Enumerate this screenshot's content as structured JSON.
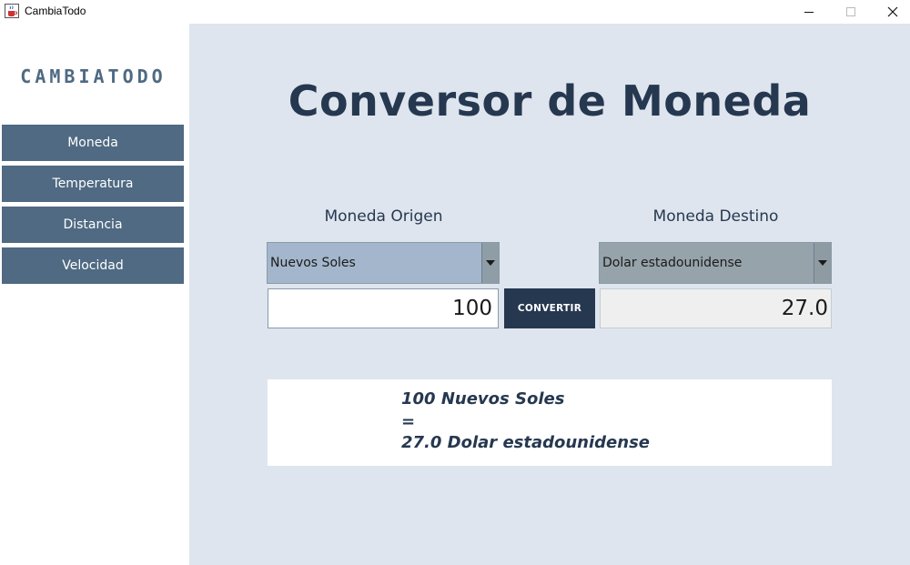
{
  "window": {
    "title": "CambiaTodo",
    "icon": "java-cup-icon",
    "controls": [
      "minimize-icon",
      "maximize-icon",
      "close-icon"
    ]
  },
  "sidebar": {
    "brand": "CAMBIATODO",
    "items": [
      {
        "label": "Moneda"
      },
      {
        "label": "Temperatura"
      },
      {
        "label": "Distancia"
      },
      {
        "label": "Velocidad"
      }
    ]
  },
  "main": {
    "title": "Conversor de Moneda",
    "origin_label": "Moneda Origen",
    "destination_label": "Moneda Destino",
    "origin_currency": "Nuevos Soles",
    "destination_currency": "Dolar estadounidense",
    "amount": "100",
    "convert_label": "CONVERTIR",
    "result_value": "27.0",
    "result_lines": [
      "100 Nuevos Soles",
      "=",
      "27.0 Dolar estadounidense"
    ]
  },
  "colors": {
    "sidebar_button": "#4f6a82",
    "main_background": "#dee5ee",
    "title_text": "#263850",
    "convert_button": "#263850",
    "origin_select": "#a3b6cc",
    "destination_select": "#96a3aa"
  }
}
